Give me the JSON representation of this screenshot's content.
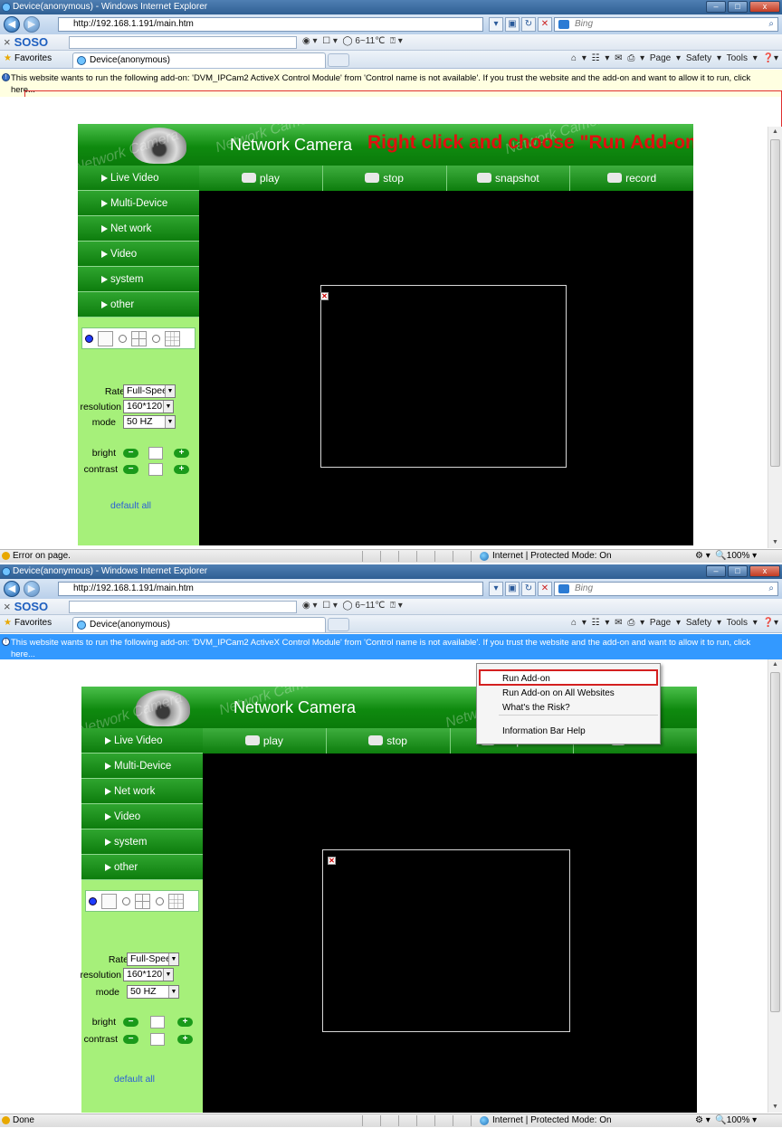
{
  "browser": {
    "window_title": "Device(anonymous) - Windows Internet Explorer",
    "address": "http://192.168.1.191/main.htm",
    "search_placeholder": "Bing",
    "soso_logo": "SOSO",
    "soso_close": "×",
    "weather": "6~11℃",
    "favorites_label": "Favorites",
    "tab_title": "Device(anonymous)",
    "cmd_page": "Page",
    "cmd_safety": "Safety",
    "cmd_tools": "Tools",
    "infobar_text": "This website wants to run the following add-on: 'DVM_IPCam2 ActiveX Control Module' from 'Control name is not available'. If you trust the website and the add-on and want to allow it to run, click here...",
    "zone_text": "Internet | Protected Mode: On",
    "zoom_text": "100%",
    "status_top": "Error on page.",
    "status_bottom": "Done"
  },
  "camera": {
    "title": "Network Camera",
    "watermark": "Network Camera",
    "annotation": "Right click and choose \"Run Add-on\"",
    "toolbar": [
      "play",
      "stop",
      "snapshot",
      "record"
    ],
    "menu": [
      "Live Video",
      "Multi-Device",
      "Net work",
      "Video",
      "system",
      "other"
    ],
    "rate_label": "Rate",
    "rate_value": "Full-Speed",
    "resolution_label": "resolution",
    "resolution_value": "160*120",
    "mode_label": "mode",
    "mode_value": "50 HZ",
    "bright_label": "bright",
    "contrast_label": "contrast",
    "minus": "−",
    "plus": "+",
    "default_all": "default all"
  },
  "context_menu": {
    "items": [
      "Run Add-on",
      "Run Add-on on All Websites",
      "What's the Risk?",
      "Information Bar Help"
    ]
  }
}
